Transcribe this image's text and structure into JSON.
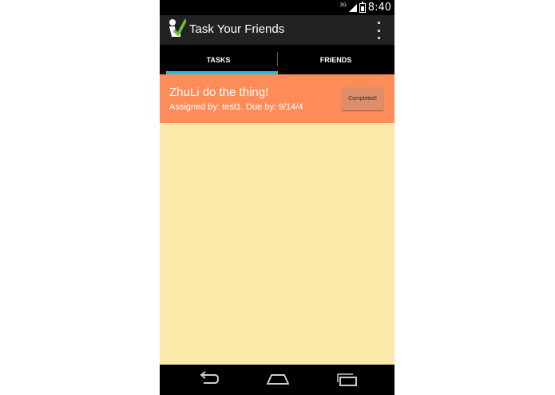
{
  "status_bar": {
    "network": "3G",
    "time": "8:40"
  },
  "action_bar": {
    "title": "Task Your Friends"
  },
  "tabs": [
    {
      "label": "TASKS",
      "selected": true
    },
    {
      "label": "FRIENDS",
      "selected": false
    }
  ],
  "task": {
    "title": "ZhuLi do the thing!",
    "subtitle": "Assigned by: test1. Due by: 9/14/4",
    "button_label": "Completed!"
  },
  "colors": {
    "task_background": "#fe8c58",
    "content_background": "#fbe9a9",
    "tab_indicator": "#33b5e5",
    "action_bar": "#222222"
  },
  "icons": {
    "app": "app-logo-icon",
    "overflow": "overflow-menu-icon",
    "back": "back-icon",
    "home": "home-icon",
    "recents": "recent-apps-icon"
  }
}
